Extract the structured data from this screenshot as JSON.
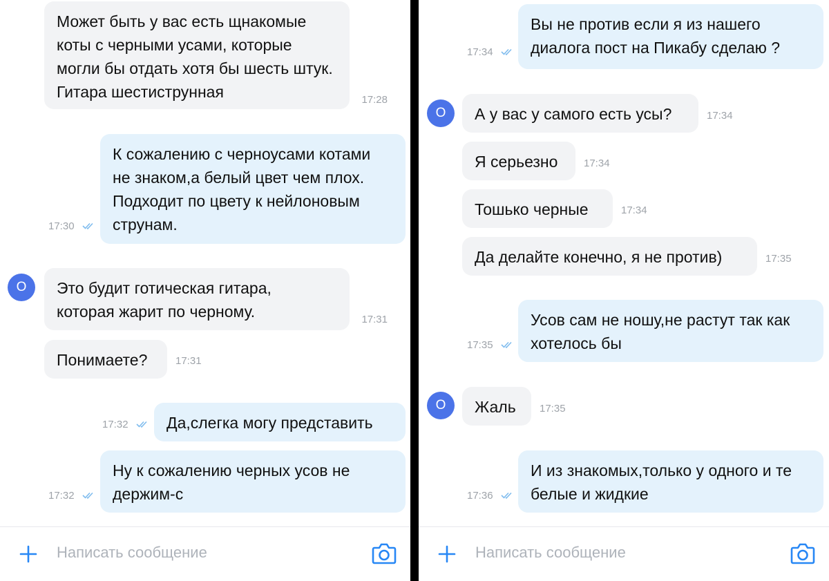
{
  "left": {
    "messages": [
      {
        "text": "Может быть у вас есть щнакомые коты с черными усами, которые могли бы отдать хотя бы шесть штук. Гитара шестиструнная",
        "time": "17:28"
      },
      {
        "text": "К сожалению с черноусами котами не знаком,а белый цвет чем плох. Подходит по цвету к нейлоновым струнам.",
        "time": "17:30"
      },
      {
        "text": "Это будит готическая гитара, которая жарит по черному.",
        "time": "17:31"
      },
      {
        "text": "Понимаете?",
        "time": "17:31"
      },
      {
        "text": "Да,слегка могу представить",
        "time": "17:32"
      },
      {
        "text": "Ну к сожалению черных усов не держим-с",
        "time": "17:32"
      }
    ],
    "avatar": "О",
    "placeholder": "Написать сообщение"
  },
  "right": {
    "messages": [
      {
        "text": "Вы не против если я из нашего диалога пост на Пикабу сделаю ?",
        "time": "17:34"
      },
      {
        "text": "А у вас у самого есть усы?",
        "time": "17:34"
      },
      {
        "text": "Я серьезно",
        "time": "17:34"
      },
      {
        "text": "Тошько черные",
        "time": "17:34"
      },
      {
        "text": "Да делайте конечно, я не против)",
        "time": "17:35"
      },
      {
        "text": "Усов сам не ношу,не растут так как хотелось бы",
        "time": "17:35"
      },
      {
        "text": "Жаль",
        "time": "17:35"
      },
      {
        "text": "И из  знакомых,только у одного и те белые и жидкие",
        "time": "17:36"
      }
    ],
    "avatar": "О",
    "placeholder": "Написать сообщение"
  },
  "colors": {
    "incoming_bubble": "#f2f3f5",
    "outgoing_bubble": "#e4f2fc",
    "avatar": "#4b73e8",
    "accent": "#2787f5",
    "read_checks": "#7fbcee"
  },
  "icons": {
    "attach": "plus-icon",
    "camera": "camera-icon",
    "read_status": "double-check-icon"
  }
}
